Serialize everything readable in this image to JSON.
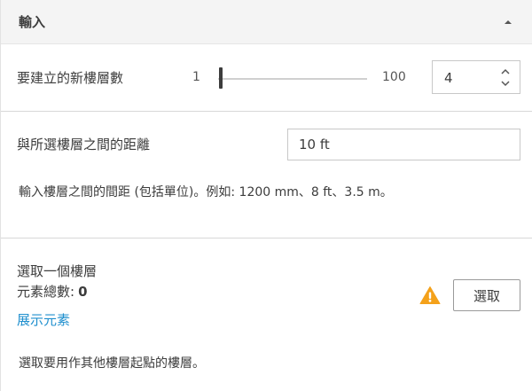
{
  "header": {
    "title": "輸入",
    "collapse_icon": "caret-up-icon"
  },
  "levels_count": {
    "label": "要建立的新樓層數",
    "slider_min": "1",
    "slider_max": "100",
    "slider_value": 4,
    "stepper_value": "4"
  },
  "distance": {
    "label": "與所選樓層之間的距離",
    "value": "10 ft",
    "help": "輸入樓層之間的間距 (包括單位)。例如: 1200 mm、8 ft、3.5 m。"
  },
  "select_level": {
    "title": "選取一個樓層",
    "count_label": "元素總數:",
    "count_value": "0",
    "show_elements_link": "展示元素",
    "select_button": "選取",
    "help": "選取要用作其他樓層起點的樓層。",
    "warning_icon": "warning-triangle-icon",
    "warning_color": "#f4a11a"
  },
  "colors": {
    "header_bg": "#f4f4f4",
    "link": "#1f8fce"
  }
}
